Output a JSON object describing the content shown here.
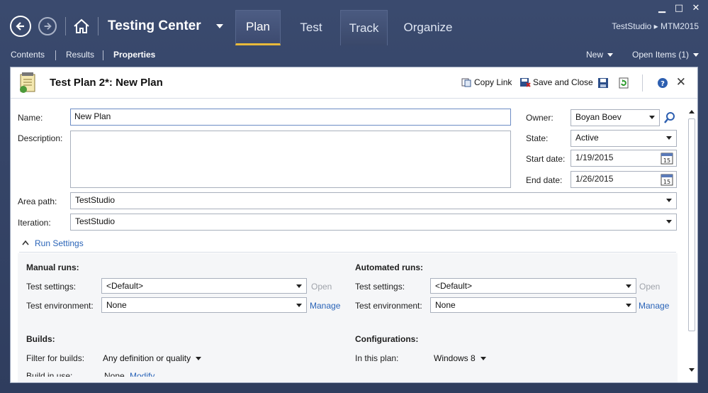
{
  "window": {
    "minimize": "▁",
    "maximize": "□",
    "close": "✕"
  },
  "header": {
    "app_title": "Testing Center",
    "tabs": [
      {
        "label": "Plan"
      },
      {
        "label": "Test"
      },
      {
        "label": "Track"
      },
      {
        "label": "Organize"
      }
    ],
    "team_path": "TestStudio ▸ MTM2015"
  },
  "subnav": {
    "items": [
      "Contents",
      "Results",
      "Properties"
    ],
    "new_label": "New",
    "open_items_label": "Open Items (1)"
  },
  "panel": {
    "title": "Test Plan 2*: New Plan",
    "copy_link": "Copy Link",
    "save_close": "Save and Close"
  },
  "form": {
    "name_label": "Name:",
    "name_value": "New Plan",
    "description_label": "Description:",
    "description_value": "",
    "owner_label": "Owner:",
    "owner_value": "Boyan Boev",
    "state_label": "State:",
    "state_value": "Active",
    "start_label": "Start date:",
    "start_value": "1/19/2015",
    "end_label": "End date:",
    "end_value": "1/26/2015",
    "cal_day": "15",
    "area_label": "Area path:",
    "area_value": "TestStudio",
    "iteration_label": "Iteration:",
    "iteration_value": "TestStudio"
  },
  "run_settings": {
    "toggle_label": "Run Settings",
    "manual_title": "Manual runs:",
    "automated_title": "Automated runs:",
    "test_settings_label": "Test settings:",
    "test_env_label": "Test environment:",
    "manual_settings_value": "<Default>",
    "manual_env_value": "None",
    "auto_settings_value": "<Default>",
    "auto_env_value": "None",
    "open_label": "Open",
    "manage_label": "Manage"
  },
  "builds": {
    "title": "Builds:",
    "filter_label": "Filter for builds:",
    "filter_value": "Any definition or quality",
    "in_use_label": "Build in use:",
    "in_use_value": "None",
    "modify_label": "Modify"
  },
  "configurations": {
    "title": "Configurations:",
    "in_plan_label": "In this plan:",
    "in_plan_value": "Windows 8"
  },
  "colors": {
    "chrome": "#3a4a6e",
    "active_tab_underline": "#e8b93a",
    "link": "#2a64b8"
  }
}
